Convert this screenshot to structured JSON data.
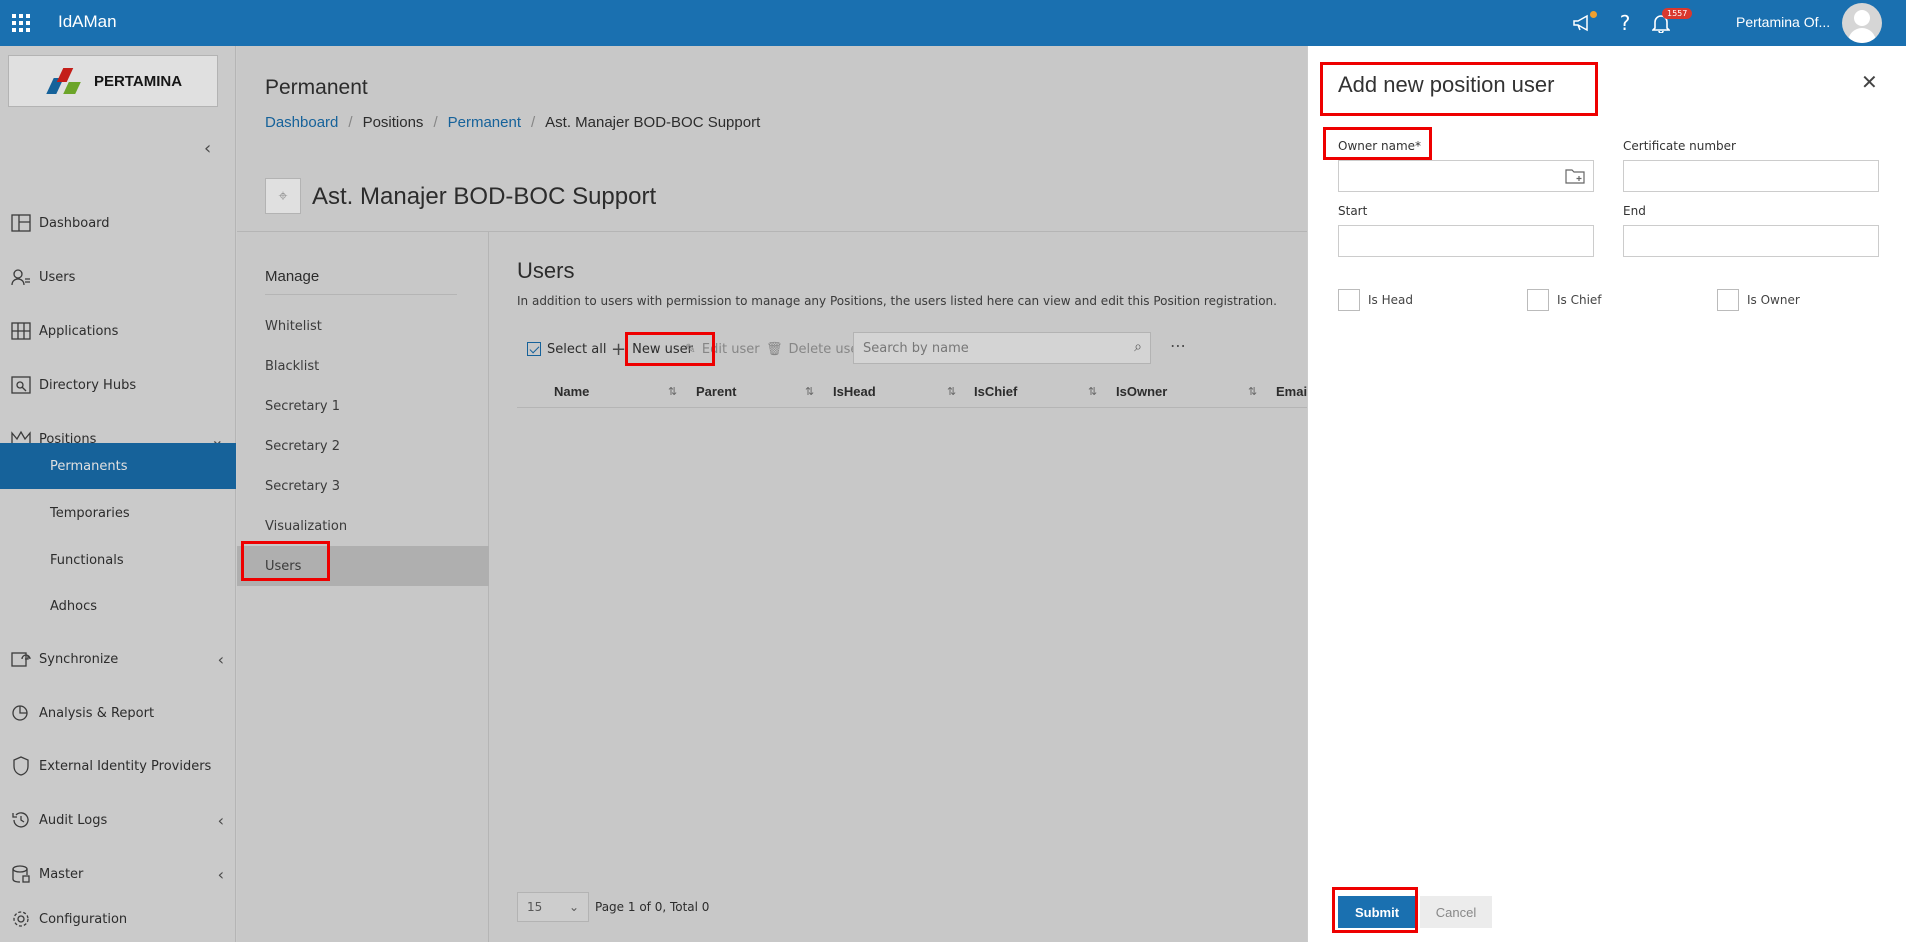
{
  "header": {
    "app_title": "IdAMan",
    "notification_count": "1557",
    "user_name": "Pertamina Of...",
    "accent_color": "#1a70b0"
  },
  "sidebar": {
    "logo_text": "PERTAMINA",
    "items": [
      {
        "label": "Dashboard",
        "icon": "dashboard-icon"
      },
      {
        "label": "Users",
        "icon": "users-icon"
      },
      {
        "label": "Applications",
        "icon": "applications-icon"
      },
      {
        "label": "Directory Hubs",
        "icon": "directory-hubs-icon"
      },
      {
        "label": "Positions",
        "icon": "positions-icon"
      },
      {
        "label": "Synchronize",
        "icon": "synchronize-icon"
      },
      {
        "label": "Analysis & Report",
        "icon": "analysis-icon"
      },
      {
        "label": "External Identity Providers",
        "icon": "shield-icon"
      },
      {
        "label": "Audit Logs",
        "icon": "history-icon"
      },
      {
        "label": "Master",
        "icon": "database-icon"
      },
      {
        "label": "Configuration",
        "icon": "gear-icon"
      }
    ],
    "positions_sub": [
      "Permanents",
      "Temporaries",
      "Functionals",
      "Adhocs"
    ]
  },
  "page": {
    "title": "Permanent",
    "breadcrumb": [
      "Dashboard",
      "Positions",
      "Permanent",
      "Ast. Manajer BOD-BOC Support"
    ],
    "position_title": "Ast. Manajer BOD-BOC Support"
  },
  "manage": {
    "title": "Manage",
    "items": [
      "Whitelist",
      "Blacklist",
      "Secretary 1",
      "Secretary 2",
      "Secretary 3",
      "Visualization",
      "Users"
    ]
  },
  "users": {
    "title": "Users",
    "description": "In addition to users with permission to manage any Positions, the users listed here can view and edit this Position registration.",
    "toolbar": {
      "select_all": "Select all",
      "new_user": "New user",
      "edit_user": "Edit user",
      "delete_user": "Delete user",
      "search_placeholder": "Search by name"
    },
    "columns": [
      "Name",
      "Parent",
      "IsHead",
      "IsChief",
      "IsOwner",
      "Email"
    ],
    "page_size": "15",
    "pager_text": "Page 1 of 0, Total 0"
  },
  "drawer": {
    "title": "Add new position user",
    "owner_name_label": "Owner name*",
    "certificate_label": "Certificate number",
    "start_label": "Start",
    "end_label": "End",
    "is_head": "Is Head",
    "is_chief": "Is Chief",
    "is_owner": "Is Owner",
    "submit": "Submit",
    "cancel": "Cancel"
  }
}
